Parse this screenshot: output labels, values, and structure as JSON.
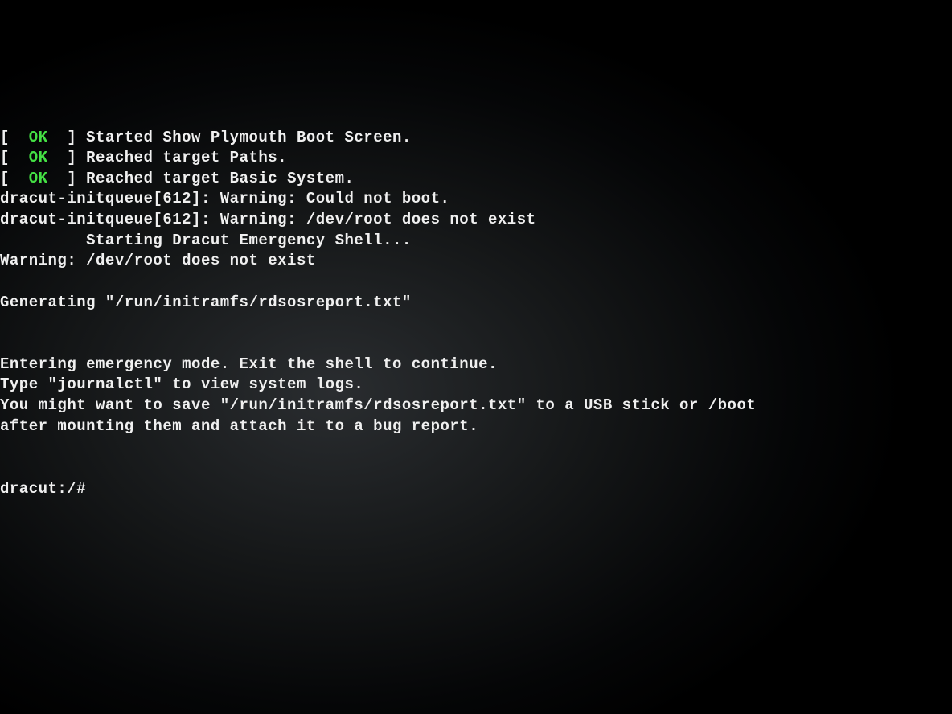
{
  "lines": [
    {
      "segments": [
        {
          "t": "[  ",
          "c": "white"
        },
        {
          "t": "OK",
          "c": "ok"
        },
        {
          "t": "  ] Started Show Plymouth Boot Screen.",
          "c": "white"
        }
      ]
    },
    {
      "segments": [
        {
          "t": "[  ",
          "c": "white"
        },
        {
          "t": "OK",
          "c": "ok"
        },
        {
          "t": "  ] Reached target Paths.",
          "c": "white"
        }
      ]
    },
    {
      "segments": [
        {
          "t": "[  ",
          "c": "white"
        },
        {
          "t": "OK",
          "c": "ok"
        },
        {
          "t": "  ] Reached target Basic System.",
          "c": "white"
        }
      ]
    },
    {
      "segments": [
        {
          "t": "dracut-initqueue[612]: Warning: Could not boot.",
          "c": "white"
        }
      ]
    },
    {
      "segments": [
        {
          "t": "dracut-initqueue[612]: Warning: /dev/root does not exist",
          "c": "white"
        }
      ]
    },
    {
      "segments": [
        {
          "t": "         Starting Dracut Emergency Shell...",
          "c": "white"
        }
      ]
    },
    {
      "segments": [
        {
          "t": "Warning: /dev/root does not exist",
          "c": "white"
        }
      ]
    },
    {
      "segments": [
        {
          "t": "",
          "c": "white"
        }
      ]
    },
    {
      "segments": [
        {
          "t": "Generating \"/run/initramfs/rdsosreport.txt\"",
          "c": "white"
        }
      ]
    },
    {
      "segments": [
        {
          "t": "",
          "c": "white"
        }
      ]
    },
    {
      "segments": [
        {
          "t": "",
          "c": "white"
        }
      ]
    },
    {
      "segments": [
        {
          "t": "Entering emergency mode. Exit the shell to continue.",
          "c": "white"
        }
      ]
    },
    {
      "segments": [
        {
          "t": "Type \"journalctl\" to view system logs.",
          "c": "white"
        }
      ]
    },
    {
      "segments": [
        {
          "t": "You might want to save \"/run/initramfs/rdsosreport.txt\" to a USB stick or /boot",
          "c": "white"
        }
      ]
    },
    {
      "segments": [
        {
          "t": "after mounting them and attach it to a bug report.",
          "c": "white"
        }
      ]
    },
    {
      "segments": [
        {
          "t": "",
          "c": "white"
        }
      ]
    },
    {
      "segments": [
        {
          "t": "",
          "c": "white"
        }
      ]
    },
    {
      "segments": [
        {
          "t": "dracut:/# ",
          "c": "white"
        }
      ],
      "prompt": true
    }
  ],
  "colors": {
    "ok": "#44e044",
    "text": "#f0f0f0",
    "background": "#000000"
  }
}
